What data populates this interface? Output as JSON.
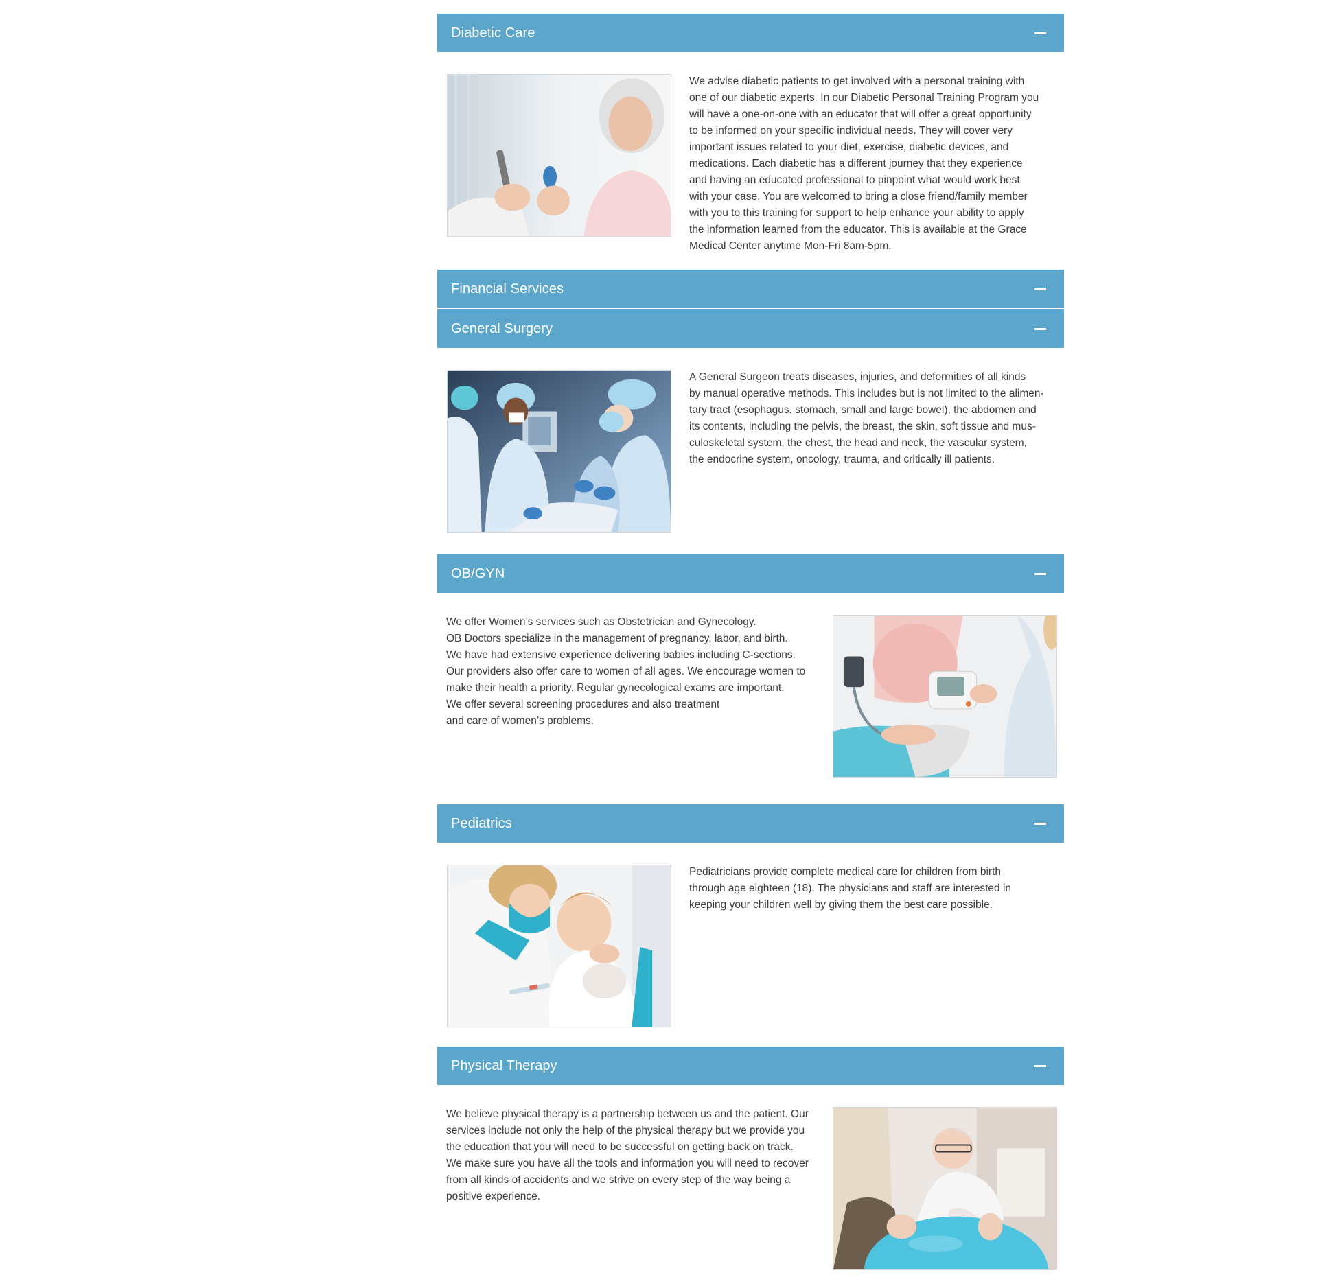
{
  "accordion": {
    "toggle_icon": "minus-icon",
    "header_color": "#5ca5cb",
    "sections": [
      {
        "title": "Diabetic Care",
        "image_icon": "diabetic-care-photo",
        "lines": [
          "We advise diabetic patients to get involved with a personal training with",
          "one of our diabetic experts. In our Diabetic Personal Training Program you",
          "will have a one-on-one with an educator that will offer a great opportunity",
          "to be informed on your specific individual needs. They will cover very",
          "important issues related to your diet, exercise, diabetic devices, and",
          "medications. Each diabetic has a different journey that they experience",
          "and having an educated professional to pinpoint what would work best",
          "with your case. You are welcomed to bring a close friend/family member",
          "with you to this training for support to help enhance your ability to apply",
          "the information learned from the educator. This is available at the Grace",
          "Medical Center anytime Mon-Fri 8am-5pm."
        ]
      },
      {
        "title": "Financial Services"
      },
      {
        "title": "General Surgery",
        "image_icon": "general-surgery-photo",
        "lines": [
          "A General Surgeon treats diseases, injuries, and deformities of all kinds",
          "by manual operative methods. This includes but is not limited to the alimen-",
          "tary tract (esophagus, stomach, small and large bowel), the abdomen and",
          "its contents, including the pelvis, the breast, the skin, soft tissue and mus-",
          "culoskeletal system, the chest, the head and neck, the vascular system,",
          "the endocrine system, oncology, trauma, and critically ill patients."
        ]
      },
      {
        "title": "OB/GYN",
        "image_icon": "obgyn-photo",
        "lines": [
          "We offer Women’s services such as Obstetrician and Gynecology.",
          "OB Doctors specialize in the management of pregnancy, labor, and birth.",
          "We have had extensive experience delivering babies including C-sections.",
          "Our providers also offer care to women of all ages. We encourage women to",
          "make their health a priority. Regular gynecological exams are important.",
          "We offer several screening procedures and also treatment",
          "and care of women’s problems."
        ]
      },
      {
        "title": "Pediatrics",
        "image_icon": "pediatrics-photo",
        "lines": [
          "Pediatricians provide complete medical care for children from birth",
          "through age eighteen (18). The physicians and staff are interested in",
          "keeping your children well by giving them the best care possible."
        ]
      },
      {
        "title": "Physical Therapy",
        "image_icon": "physical-therapy-photo",
        "lines": [
          "We believe physical therapy is a partnership between us and the patient. Our",
          "services include not only the help of the physical therapy but we provide you",
          "the education that you will need to be successful on getting back on track.",
          "We make sure you have all the tools and information you will need to recover",
          "from all kinds of accidents and we strive on every step of the way being a",
          "positive experience."
        ]
      }
    ]
  }
}
